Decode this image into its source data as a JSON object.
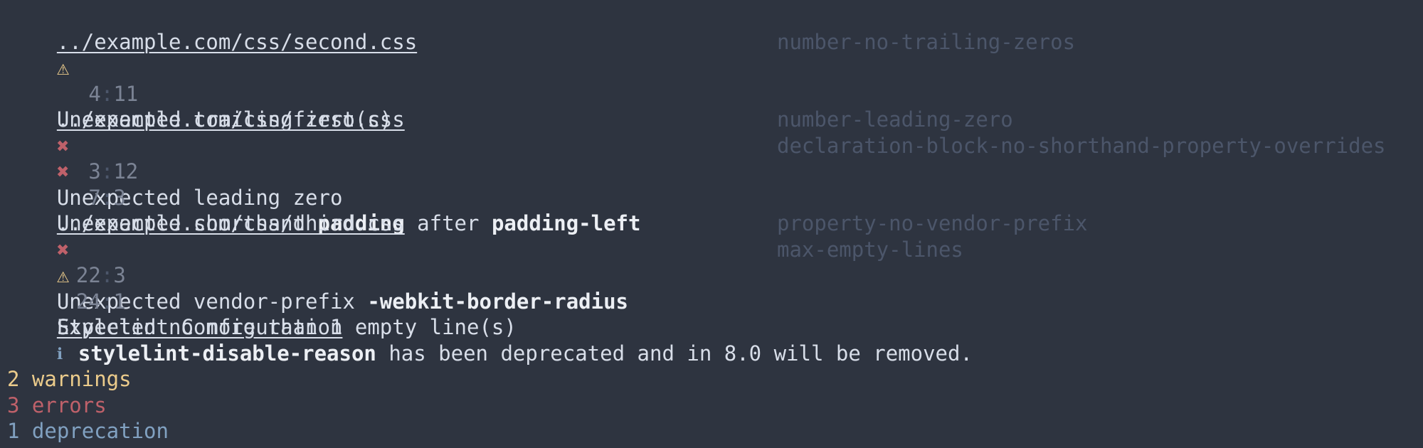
{
  "groups": [
    {
      "file": "../example.com/css/second.css",
      "results": [
        {
          "severity": "warning",
          "icon": "⚠",
          "line": "4",
          "col": "11",
          "parts": [
            {
              "t": "Unexpected trailing zero(s)",
              "b": false
            }
          ],
          "rule": "number-no-trailing-zeros"
        }
      ]
    },
    {
      "file": "../example.com/css/first.css",
      "results": [
        {
          "severity": "error",
          "icon": "✖",
          "line": "3",
          "col": "12",
          "parts": [
            {
              "t": "Unexpected leading zero",
              "b": false
            }
          ],
          "rule": "number-leading-zero"
        },
        {
          "severity": "error",
          "icon": "✖",
          "line": "7",
          "col": "3",
          "parts": [
            {
              "t": "Unexpected shorthand ",
              "b": false
            },
            {
              "t": "padding",
              "b": true
            },
            {
              "t": " after ",
              "b": false
            },
            {
              "t": "padding-left",
              "b": true
            }
          ],
          "rule": "declaration-block-no-shorthand-property-overrides"
        }
      ]
    },
    {
      "file": "../example.com/css/third.css",
      "results": [
        {
          "severity": "error",
          "icon": "✖",
          "line": "22",
          "col": "3",
          "parts": [
            {
              "t": "Unexpected vendor-prefix ",
              "b": false
            },
            {
              "t": "-webkit-border-radius",
              "b": true
            }
          ],
          "rule": "property-no-vendor-prefix"
        },
        {
          "severity": "warning",
          "icon": "⚠",
          "line": "24",
          "col": "1",
          "parts": [
            {
              "t": "Expected no more than 1 empty line(s)",
              "b": false
            }
          ],
          "rule": "max-empty-lines"
        }
      ]
    }
  ],
  "config": {
    "heading": "Stylelint Configuration",
    "icon": "ℹ",
    "option": "stylelint-disable-reason",
    "message": " has been deprecated and in 8.0 will be removed."
  },
  "summary": {
    "warnings": "2 warnings",
    "errors": "3 errors",
    "deprecations": "1 deprecation"
  },
  "colors": {
    "background": "#2e3440",
    "warning": "#ebcb8b",
    "error": "#bf616a",
    "info": "#81a1c1",
    "rule": "#4c566a"
  }
}
